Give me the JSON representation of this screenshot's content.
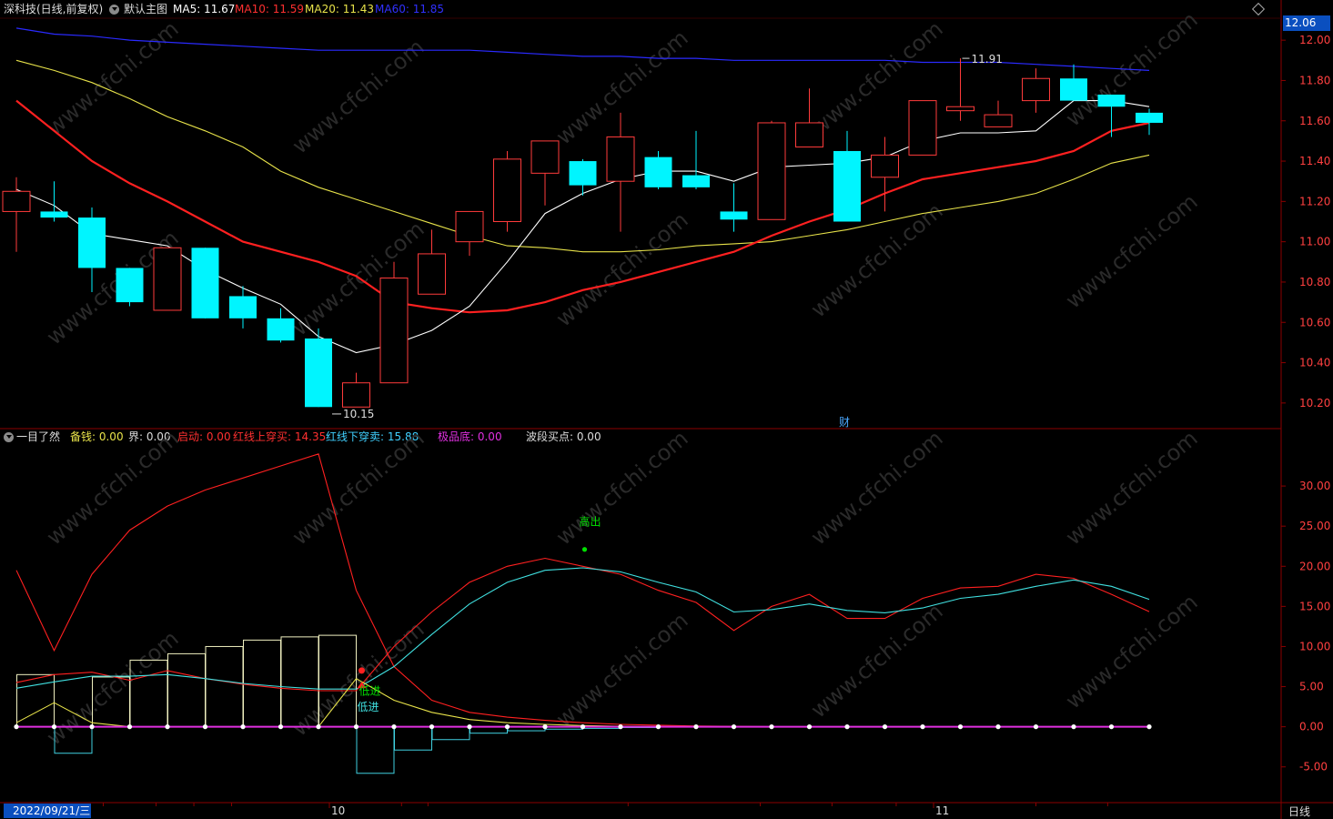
{
  "main_header": {
    "title": "深科技(日线,前复权)",
    "template": "默认主图",
    "ma5": "MA5: 11.67",
    "ma10": "MA10: 11.59",
    "ma20": "MA20: 11.43",
    "ma60": "MA60: 11.85"
  },
  "current_price": "12.06",
  "price_axis": [
    "12.00",
    "11.80",
    "11.60",
    "11.40",
    "11.20",
    "11.00",
    "10.80",
    "10.60",
    "10.40",
    "10.20"
  ],
  "annotations": {
    "high": "11.91",
    "low": "10.15",
    "cai": "财",
    "sell": "高出",
    "buy1": "低进",
    "buy2": "低进"
  },
  "indicator_header": {
    "name": "一目了然",
    "beiqian": "备钱: 0.00",
    "jie": "界: 0.00",
    "qidong": "启动: 0.00",
    "red_up": "红线上穿买: 14.35",
    "red_down": "红线下穿卖: 15.88",
    "jipindi": "极品底: 0.00",
    "boduan": "波段买点: 0.00"
  },
  "indicator_axis": [
    "30.00",
    "25.00",
    "20.00",
    "15.00",
    "10.00",
    "5.00",
    "0.00",
    "-5.00"
  ],
  "date_box": "2022/09/21/三",
  "month_labels": [
    "10",
    "11"
  ],
  "period": "日线",
  "watermark": "www.cfchi.com",
  "colors": {
    "up": "#ff3b3b",
    "down": "#00f5ff",
    "ma5": "#ffffff",
    "ma10": "#ff2020",
    "ma20": "#e8e34a",
    "ma60": "#2a2aff",
    "accent": "#0a4fbf"
  },
  "chart_data": [
    {
      "type": "candlestick",
      "title": "深科技(日线,前复权)",
      "ylim": [
        10.1,
        12.1
      ],
      "candles": [
        {
          "o": 11.15,
          "h": 11.32,
          "l": 10.95,
          "c": 11.25
        },
        {
          "o": 11.15,
          "h": 11.3,
          "l": 11.1,
          "c": 11.12
        },
        {
          "o": 11.12,
          "h": 11.17,
          "l": 10.75,
          "c": 10.87
        },
        {
          "o": 10.87,
          "h": 10.87,
          "l": 10.68,
          "c": 10.7
        },
        {
          "o": 10.66,
          "h": 10.97,
          "l": 10.66,
          "c": 10.97
        },
        {
          "o": 10.97,
          "h": 10.97,
          "l": 10.62,
          "c": 10.62
        },
        {
          "o": 10.73,
          "h": 10.78,
          "l": 10.57,
          "c": 10.62
        },
        {
          "o": 10.62,
          "h": 10.67,
          "l": 10.5,
          "c": 10.51
        },
        {
          "o": 10.52,
          "h": 10.57,
          "l": 10.18,
          "c": 10.18
        },
        {
          "o": 10.18,
          "h": 10.35,
          "l": 10.18,
          "c": 10.3
        },
        {
          "o": 10.3,
          "h": 10.9,
          "l": 10.3,
          "c": 10.82
        },
        {
          "o": 10.74,
          "h": 11.06,
          "l": 10.74,
          "c": 10.94
        },
        {
          "o": 11.0,
          "h": 11.15,
          "l": 10.93,
          "c": 11.15
        },
        {
          "o": 11.1,
          "h": 11.45,
          "l": 11.05,
          "c": 11.41
        },
        {
          "o": 11.34,
          "h": 11.5,
          "l": 11.18,
          "c": 11.5
        },
        {
          "o": 11.4,
          "h": 11.41,
          "l": 11.23,
          "c": 11.28
        },
        {
          "o": 11.3,
          "h": 11.64,
          "l": 11.05,
          "c": 11.52
        },
        {
          "o": 11.42,
          "h": 11.45,
          "l": 11.26,
          "c": 11.27
        },
        {
          "o": 11.33,
          "h": 11.55,
          "l": 11.26,
          "c": 11.27
        },
        {
          "o": 11.15,
          "h": 11.29,
          "l": 11.05,
          "c": 11.11
        },
        {
          "o": 11.11,
          "h": 11.6,
          "l": 11.11,
          "c": 11.59
        },
        {
          "o": 11.47,
          "h": 11.76,
          "l": 11.47,
          "c": 11.59
        },
        {
          "o": 11.45,
          "h": 11.55,
          "l": 11.1,
          "c": 11.1
        },
        {
          "o": 11.32,
          "h": 11.52,
          "l": 11.15,
          "c": 11.43
        },
        {
          "o": 11.43,
          "h": 11.7,
          "l": 11.43,
          "c": 11.7
        },
        {
          "o": 11.65,
          "h": 11.91,
          "l": 11.6,
          "c": 11.67
        },
        {
          "o": 11.57,
          "h": 11.7,
          "l": 11.57,
          "c": 11.63
        },
        {
          "o": 11.7,
          "h": 11.86,
          "l": 11.64,
          "c": 11.81
        },
        {
          "o": 11.81,
          "h": 11.88,
          "l": 11.7,
          "c": 11.7
        },
        {
          "o": 11.73,
          "h": 11.73,
          "l": 11.52,
          "c": 11.67
        },
        {
          "o": 11.64,
          "h": 11.66,
          "l": 11.53,
          "c": 11.59
        }
      ],
      "ma5": [
        11.26,
        11.18,
        11.04,
        11.01,
        10.98,
        10.86,
        10.77,
        10.69,
        10.53,
        10.45,
        10.49,
        10.56,
        10.68,
        10.9,
        11.14,
        11.24,
        11.31,
        11.35,
        11.35,
        11.3,
        11.37,
        11.38,
        11.39,
        11.42,
        11.5,
        11.54,
        11.54,
        11.55,
        11.7,
        11.7,
        11.67
      ],
      "ma10": [
        11.7,
        11.55,
        11.4,
        11.29,
        11.2,
        11.1,
        11.0,
        10.95,
        10.9,
        10.83,
        10.7,
        10.67,
        10.65,
        10.66,
        10.7,
        10.76,
        10.8,
        10.85,
        10.9,
        10.95,
        11.03,
        11.1,
        11.16,
        11.24,
        11.31,
        11.34,
        11.37,
        11.4,
        11.45,
        11.55,
        11.59
      ],
      "ma20": [
        11.9,
        11.85,
        11.79,
        11.71,
        11.62,
        11.55,
        11.47,
        11.35,
        11.27,
        11.21,
        11.15,
        11.09,
        11.03,
        10.98,
        10.97,
        10.95,
        10.95,
        10.96,
        10.98,
        10.99,
        11.0,
        11.03,
        11.06,
        11.1,
        11.14,
        11.17,
        11.2,
        11.24,
        11.31,
        11.39,
        11.43
      ],
      "ma60": [
        12.06,
        12.03,
        12.02,
        12.0,
        11.99,
        11.98,
        11.97,
        11.96,
        11.95,
        11.95,
        11.95,
        11.95,
        11.95,
        11.94,
        11.93,
        11.92,
        11.92,
        11.91,
        11.91,
        11.9,
        11.9,
        11.9,
        11.9,
        11.9,
        11.89,
        11.89,
        11.89,
        11.88,
        11.87,
        11.86,
        11.85
      ]
    },
    {
      "type": "line",
      "title": "一目了然",
      "ylim": [
        -9,
        35
      ],
      "series": [
        {
          "name": "红线下穿卖",
          "values": [
            19.5,
            9.5,
            19.0,
            24.5,
            27.5,
            29.5,
            31.0,
            32.5,
            34.0,
            17.0,
            7.5,
            3.3,
            1.8,
            1.2,
            0.8,
            0.5,
            0.3,
            0.2,
            0.1,
            0.05,
            0,
            0,
            0,
            0,
            0,
            0,
            0,
            0,
            0,
            0,
            0
          ]
        },
        {
          "name": "红线上穿买",
          "values": [
            5.5,
            6.5,
            6.8,
            5.8,
            7.0,
            6.0,
            5.3,
            4.8,
            4.5,
            4.5,
            10.0,
            14.3,
            18.0,
            20.0,
            21.0,
            20.0,
            19.0,
            17.0,
            15.5,
            12.0,
            15.0,
            16.5,
            13.5,
            13.5,
            16.0,
            17.3,
            17.5,
            19.0,
            18.5,
            16.5,
            14.35
          ]
        },
        {
          "name": "线3",
          "values": [
            4.8,
            5.6,
            6.3,
            6.3,
            6.5,
            6.0,
            5.4,
            5.0,
            4.7,
            4.7,
            7.5,
            11.5,
            15.3,
            18.0,
            19.5,
            19.8,
            19.3,
            18.0,
            16.8,
            14.3,
            14.6,
            15.3,
            14.5,
            14.2,
            14.8,
            16.0,
            16.5,
            17.5,
            18.3,
            17.5,
            15.88
          ]
        },
        {
          "name": "线4",
          "values": [
            0.5,
            3.0,
            0.5,
            0,
            0,
            0,
            0,
            0,
            0,
            6.0,
            3.3,
            1.8,
            0.9,
            0.5,
            0.3,
            0.15,
            0.05,
            0,
            0,
            0,
            0,
            0,
            0,
            0,
            0,
            0,
            0,
            0,
            0,
            0,
            0
          ]
        }
      ],
      "bars": [
        6.5,
        -3.3,
        6.2,
        8.3,
        9.1,
        10.0,
        10.8,
        11.2,
        11.4,
        -5.8,
        -2.9,
        -1.6,
        -0.8,
        -0.5,
        -0.3,
        -0.2,
        -0.1,
        0,
        0,
        0,
        0,
        0,
        0,
        0,
        0,
        0,
        0,
        0,
        0,
        0,
        0
      ]
    }
  ]
}
